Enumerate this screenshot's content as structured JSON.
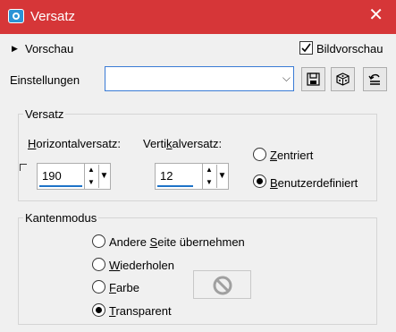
{
  "window": {
    "title": "Versatz",
    "close_glyph": "✕"
  },
  "preview": {
    "label": "Vorschau",
    "expander_icon": "triangle-right-icon"
  },
  "bildvorschau": {
    "label": "Bildvorschau",
    "checked": true
  },
  "settings": {
    "label": "Einstellungen",
    "value": "",
    "buttons": [
      "save-icon",
      "dice-icon",
      "reset-icon"
    ]
  },
  "versatz": {
    "group_label": "Versatz",
    "horizontal": {
      "label_underlined": "H",
      "label_rest": "orizontalversatz:",
      "value": "190"
    },
    "vertical": {
      "label_pre": "Verti",
      "label_underlined": "k",
      "label_rest": "alversatz:",
      "value": "12"
    },
    "radios": [
      {
        "underlined": "Z",
        "rest": "entriert",
        "checked": false
      },
      {
        "underlined": "B",
        "rest": "enutzerdefiniert",
        "checked": true
      }
    ]
  },
  "kantenmodus": {
    "group_label": "Kantenmodus",
    "options": [
      {
        "pre": "Andere ",
        "underlined": "S",
        "rest": "eite übernehmen",
        "checked": false
      },
      {
        "pre": "",
        "underlined": "W",
        "rest": "iederholen",
        "checked": false
      },
      {
        "pre": "",
        "underlined": "F",
        "rest": "arbe",
        "checked": false
      },
      {
        "pre": "",
        "underlined": "T",
        "rest": "ransparent",
        "checked": true
      }
    ],
    "color_swatch_icon": "no-color-icon"
  },
  "colors": {
    "titlebar": "#d63638",
    "accent": "#1e73c8"
  }
}
